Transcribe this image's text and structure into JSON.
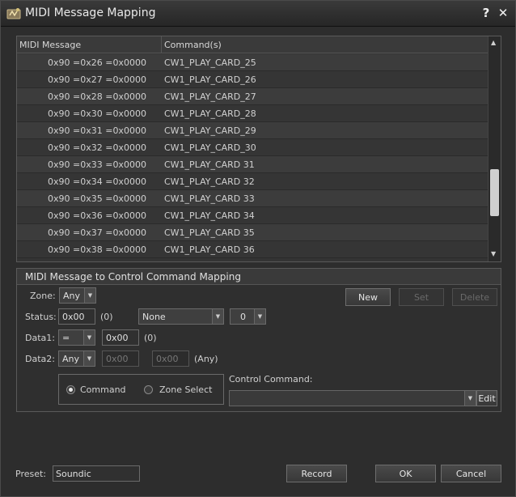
{
  "window": {
    "title": "MIDI Message Mapping",
    "help": "?",
    "close": "✕"
  },
  "list": {
    "columns": [
      "MIDI Message",
      "Command(s)"
    ],
    "rows": [
      {
        "msg": "0x90 =0x26 =0x0000",
        "cmd": "CW1_PLAY_CARD_25"
      },
      {
        "msg": "0x90 =0x27 =0x0000",
        "cmd": "CW1_PLAY_CARD_26"
      },
      {
        "msg": "0x90 =0x28 =0x0000",
        "cmd": "CW1_PLAY_CARD_27"
      },
      {
        "msg": "0x90 =0x30 =0x0000",
        "cmd": "CW1_PLAY_CARD_28"
      },
      {
        "msg": "0x90 =0x31 =0x0000",
        "cmd": "CW1_PLAY_CARD_29"
      },
      {
        "msg": "0x90 =0x32 =0x0000",
        "cmd": "CW1_PLAY_CARD_30"
      },
      {
        "msg": "0x90 =0x33 =0x0000",
        "cmd": "CW1_PLAY_CARD 31"
      },
      {
        "msg": "0x90 =0x34 =0x0000",
        "cmd": "CW1_PLAY_CARD 32"
      },
      {
        "msg": "0x90 =0x35 =0x0000",
        "cmd": "CW1_PLAY_CARD 33"
      },
      {
        "msg": "0x90 =0x36 =0x0000",
        "cmd": "CW1_PLAY_CARD 34"
      },
      {
        "msg": "0x90 =0x37 =0x0000",
        "cmd": "CW1_PLAY_CARD 35"
      },
      {
        "msg": "0x90 =0x38 =0x0000",
        "cmd": "CW1_PLAY_CARD 36"
      }
    ]
  },
  "mapping": {
    "title": "MIDI Message to Control Command Mapping",
    "zone_label": "Zone:",
    "zone_value": "Any",
    "status_label": "Status:",
    "status_value": "0x00",
    "status_decimal": "(0)",
    "status_type": "None",
    "status_channel": "0",
    "data1_label": "Data1:",
    "data1_op": "=",
    "data1_value": "0x00",
    "data1_decimal": "(0)",
    "data2_label": "Data2:",
    "data2_op": "Any",
    "data2_low": "0x00",
    "data2_high": "0x00",
    "data2_note": "(Any)",
    "new_label": "New",
    "set_label": "Set",
    "delete_label": "Delete",
    "radio_command": "Command",
    "radio_zone_select": "Zone Select",
    "control_command_label": "Control Command:",
    "control_command_value": "",
    "edit_label": "Edit"
  },
  "footer": {
    "preset_label": "Preset:",
    "preset_value": "Soundic",
    "record_label": "Record",
    "ok_label": "OK",
    "cancel_label": "Cancel"
  },
  "colors": {
    "background": "#2d2d2d",
    "text": "#d0d0d0",
    "border": "#6a6a6a"
  }
}
